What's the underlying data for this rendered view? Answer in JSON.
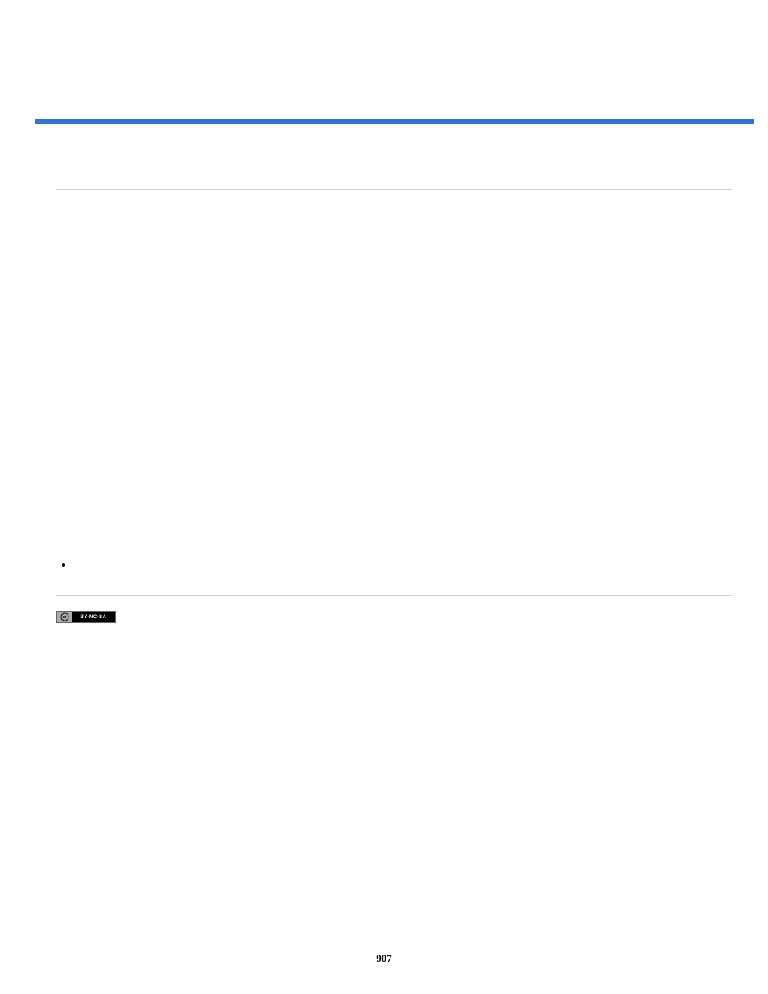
{
  "page_number": "907",
  "cc_badge_text": "BY-NC-SA"
}
